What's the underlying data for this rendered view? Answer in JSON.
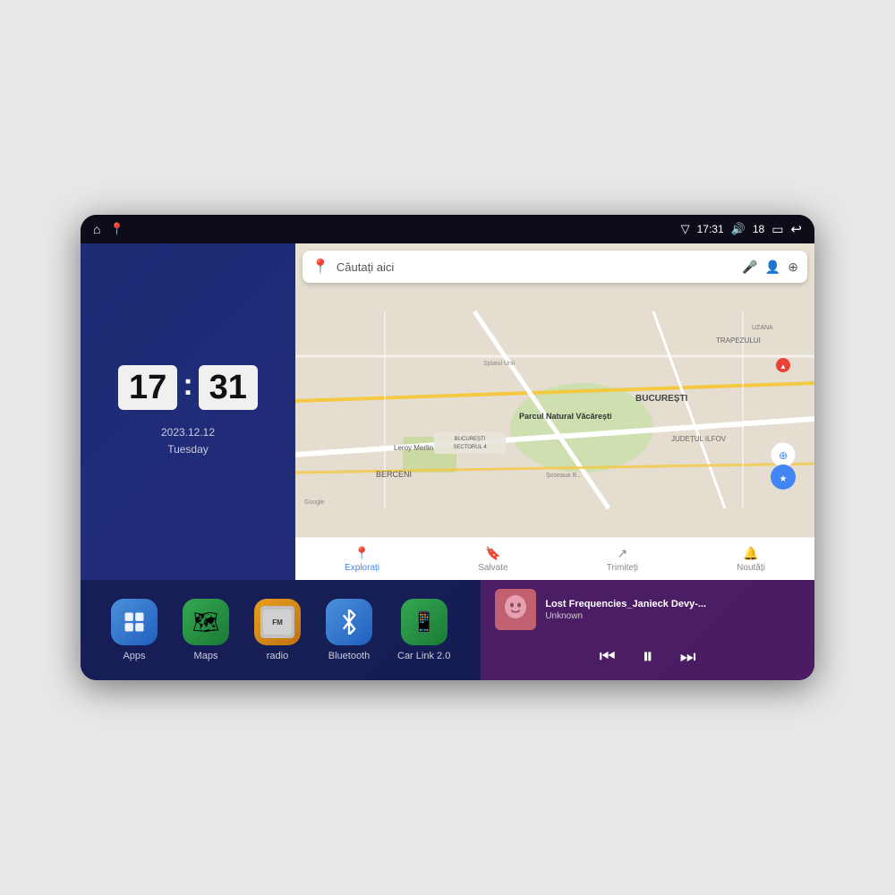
{
  "device": {
    "status_bar": {
      "left_icons": [
        "home-icon",
        "maps-icon"
      ],
      "time": "17:31",
      "signal_icon": "signal-icon",
      "volume_icon": "volume-icon",
      "volume_level": "18",
      "battery_icon": "battery-icon",
      "back_icon": "back-icon"
    },
    "clock": {
      "hour": "17",
      "minute": "31",
      "date": "2023.12.12",
      "day": "Tuesday"
    },
    "map": {
      "search_placeholder": "Căutați aici",
      "bottom_items": [
        {
          "label": "Explorați",
          "icon": "explore-icon"
        },
        {
          "label": "Salvate",
          "icon": "saved-icon"
        },
        {
          "label": "Trimiteți",
          "icon": "share-icon"
        },
        {
          "label": "Noutăți",
          "icon": "news-icon"
        }
      ],
      "locations": [
        "Parcul Natural Văcărești",
        "Leroy Merlin",
        "BUCUREȘTI",
        "JUDEȚUL ILFOV",
        "BERCENI",
        "TRAPEZULUI",
        "UZANA",
        "Splaiul Unii",
        "Șoseaua B..."
      ],
      "google_label": "Google"
    },
    "apps": [
      {
        "id": "apps",
        "label": "Apps",
        "icon_class": "icon-apps",
        "icon_char": "⊞"
      },
      {
        "id": "maps",
        "label": "Maps",
        "icon_class": "icon-maps",
        "icon_char": "📍"
      },
      {
        "id": "radio",
        "label": "radio",
        "icon_class": "icon-radio",
        "icon_char": "📻"
      },
      {
        "id": "bluetooth",
        "label": "Bluetooth",
        "icon_class": "icon-bluetooth",
        "icon_char": "⚡"
      },
      {
        "id": "carlink",
        "label": "Car Link 2.0",
        "icon_class": "icon-carlink",
        "icon_char": "📱"
      }
    ],
    "music": {
      "title": "Lost Frequencies_Janieck Devy-...",
      "artist": "Unknown",
      "prev_label": "⏮",
      "play_label": "⏸",
      "next_label": "⏭"
    }
  }
}
